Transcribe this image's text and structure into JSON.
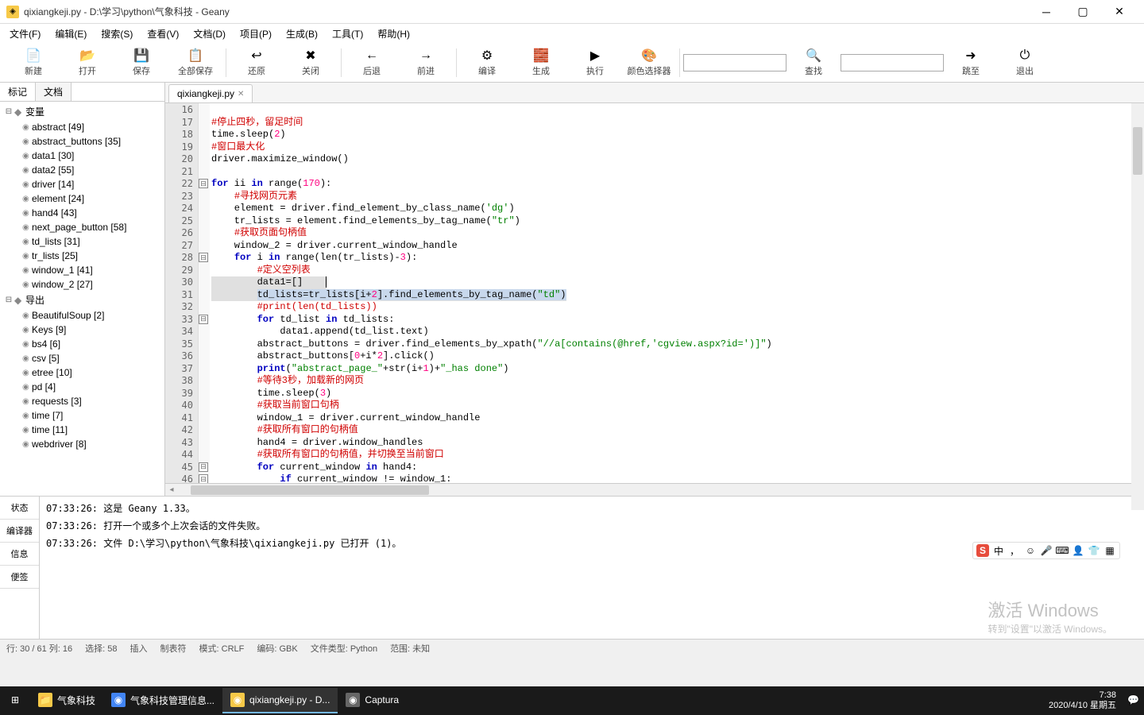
{
  "title": "qixiangkeji.py - D:\\学习\\python\\气象科技 - Geany",
  "menu": [
    "文件(F)",
    "编辑(E)",
    "搜索(S)",
    "查看(V)",
    "文档(D)",
    "项目(P)",
    "生成(B)",
    "工具(T)",
    "帮助(H)"
  ],
  "toolbar": [
    {
      "label": "新建",
      "icon": "📄"
    },
    {
      "label": "打开",
      "icon": "📂"
    },
    {
      "label": "保存",
      "icon": "💾"
    },
    {
      "label": "全部保存",
      "icon": "📋"
    },
    {
      "label": "还原",
      "icon": "↩"
    },
    {
      "label": "关闭",
      "icon": "✖"
    },
    {
      "label": "后退",
      "icon": "←"
    },
    {
      "label": "前进",
      "icon": "→"
    },
    {
      "label": "编译",
      "icon": "⚙"
    },
    {
      "label": "生成",
      "icon": "🧱"
    },
    {
      "label": "执行",
      "icon": "▶"
    },
    {
      "label": "颜色选择器",
      "icon": "🎨"
    },
    {
      "label": "查找",
      "icon": "🔍"
    },
    {
      "label": "跳至",
      "icon": "➜"
    },
    {
      "label": "退出",
      "icon": "⏻"
    }
  ],
  "side_tabs": [
    "标记",
    "文档"
  ],
  "tree_groups": [
    {
      "name": "变量",
      "items": [
        {
          "t": "abstract [49]"
        },
        {
          "t": "abstract_buttons [35]"
        },
        {
          "t": "data1 [30]"
        },
        {
          "t": "data2 [55]"
        },
        {
          "t": "driver [14]"
        },
        {
          "t": "element [24]"
        },
        {
          "t": "hand4 [43]"
        },
        {
          "t": "next_page_button [58]"
        },
        {
          "t": "td_lists [31]"
        },
        {
          "t": "tr_lists [25]"
        },
        {
          "t": "window_1 [41]"
        },
        {
          "t": "window_2 [27]"
        }
      ]
    },
    {
      "name": "导出",
      "items": [
        {
          "t": "BeautifulSoup [2]"
        },
        {
          "t": "Keys [9]"
        },
        {
          "t": "bs4 [6]"
        },
        {
          "t": "csv [5]"
        },
        {
          "t": "etree [10]"
        },
        {
          "t": "pd [4]"
        },
        {
          "t": "requests [3]"
        },
        {
          "t": "time [7]"
        },
        {
          "t": "time [11]"
        },
        {
          "t": "webdriver [8]"
        }
      ]
    }
  ],
  "file_tab": "qixiangkeji.py",
  "lines_start": 16,
  "messages": {
    "line1": "07:33:26: 这是 Geany 1.33。",
    "line2": "07:33:26: 打开一个或多个上次会话的文件失败。",
    "line3": "07:33:26: 文件 D:\\学习\\python\\气象科技\\qixiangkeji.py 已打开 (1)。"
  },
  "bottom_tabs": [
    "状态",
    "编译器",
    "信息",
    "便签"
  ],
  "status": {
    "pos": "行: 30 / 61  列: 16",
    "sel": "选择: 58",
    "ins": "插入",
    "tab": "制表符",
    "mode": "模式: CRLF",
    "enc": "编码: GBK",
    "ftype": "文件类型: Python",
    "scope": "范围: 未知"
  },
  "watermark": {
    "big": "激活 Windows",
    "small": "转到\"设置\"以激活 Windows。"
  },
  "taskbar": {
    "items": [
      {
        "label": "气象科技",
        "icon": "📁",
        "color": "#f7c948"
      },
      {
        "label": "气象科技管理信息...",
        "icon": "◉",
        "color": "#4285f4"
      },
      {
        "label": "qixiangkeji.py - D...",
        "icon": "◉",
        "color": "#f7c948"
      },
      {
        "label": "Captura",
        "icon": "◉",
        "color": "#666"
      }
    ],
    "time": "7:38",
    "date": "2020/4/10 星期五"
  },
  "ime": "中"
}
